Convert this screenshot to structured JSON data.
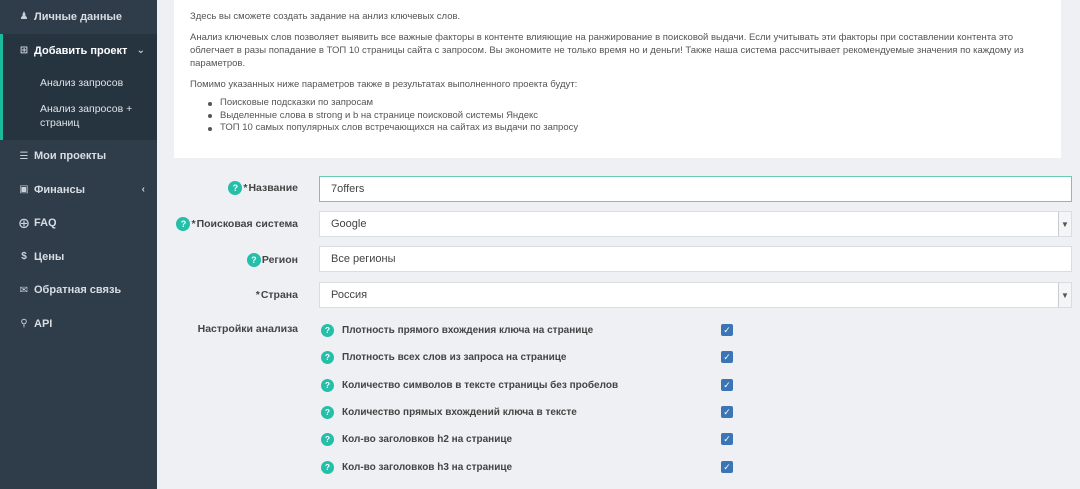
{
  "sidebar": {
    "items": [
      {
        "label": "Личные данные",
        "icon": "user-icon"
      },
      {
        "label": "Добавить проект",
        "icon": "plus-square-icon",
        "active": true
      },
      {
        "label": "Мои проекты",
        "icon": "list-icon"
      },
      {
        "label": "Финансы",
        "icon": "wallet-icon"
      },
      {
        "label": "FAQ",
        "icon": "lifebuoy-icon"
      },
      {
        "label": "Цены",
        "icon": "dollar-icon"
      },
      {
        "label": "Обратная связь",
        "icon": "envelope-icon"
      },
      {
        "label": "API",
        "icon": "key-icon"
      }
    ],
    "submenu": [
      "Анализ запросов",
      "Анализ запросов + страниц"
    ]
  },
  "info": {
    "p1": "Здесь вы сможете создать задание на анлиз ключевых слов.",
    "p2": "Анализ ключевых слов позволяет выявить все важные факторы в контенте влияющие на ранжирование в поисковой выдачи. Если учитывать эти факторы при составлении контента это облегчает в разы попадание в ТОП 10 страницы сайта с запросом. Вы экономите не только время но и деньги! Также наша система рассчитывает рекомендуемые значения по каждому из параметров.",
    "p3": "Помимо указанных ниже параметров также в результатах выполненного проекта будут:",
    "bullets": [
      "Поисковые подсказки по запросам",
      "Выделенные слова в strong и b на странице поисковой системы Яндекс",
      "ТОП 10 самых популярных слов встречающихся на сайтах из выдачи по запросу"
    ]
  },
  "form": {
    "name_label": "Название",
    "name_value": "7offers",
    "engine_label": "Поисковая система",
    "engine_value": "Google",
    "region_label": "Регион",
    "region_value": "Все регионы",
    "country_label": "Страна",
    "country_value": "Россия",
    "settings_label": "Настройки анализа",
    "required_mark": "*",
    "help_glyph": "?",
    "options": [
      {
        "label": "Плотность прямого вхождения ключа на странице",
        "checked": true
      },
      {
        "label": "Плотность всех слов из запроса на странице",
        "checked": true
      },
      {
        "label": "Количество символов в тексте страницы без пробелов",
        "checked": true
      },
      {
        "label": "Количество прямых вхождений ключа в тексте",
        "checked": true
      },
      {
        "label": "Кол-во заголовков h2 на странице",
        "checked": true
      },
      {
        "label": "Кол-во заголовков h3 на странице",
        "checked": true
      }
    ]
  },
  "colors": {
    "sidebar": "#2f3d4a",
    "accent": "#1abc9c",
    "help": "#23bfa8",
    "checkbox": "#3b75b5"
  }
}
